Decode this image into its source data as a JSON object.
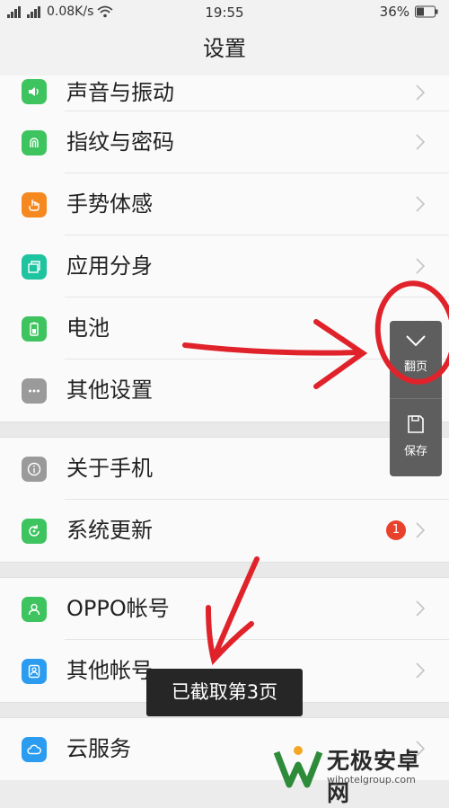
{
  "statusbar": {
    "network_text": "0.08K/s",
    "time": "19:55",
    "battery": "36%"
  },
  "header": {
    "title": "设置"
  },
  "groups": [
    {
      "items": [
        {
          "label": "声音与振动",
          "icon": "speaker-icon",
          "color": "#3ec45f"
        },
        {
          "label": "指纹与密码",
          "icon": "fingerprint-icon",
          "color": "#3ec45f"
        },
        {
          "label": "手势体感",
          "icon": "gesture-hand-icon",
          "color": "#f5891f"
        },
        {
          "label": "应用分身",
          "icon": "app-clone-icon",
          "color": "#1ec3a0"
        },
        {
          "label": "电池",
          "icon": "battery-icon",
          "color": "#3ec45f"
        },
        {
          "label": "其他设置",
          "icon": "more-dots-icon",
          "color": "#9a9a9a"
        }
      ]
    },
    {
      "items": [
        {
          "label": "关于手机",
          "icon": "info-icon",
          "color": "#9a9a9a"
        },
        {
          "label": "系统更新",
          "icon": "update-icon",
          "color": "#3ec45f",
          "badge": "1"
        }
      ]
    },
    {
      "items": [
        {
          "label": "OPPO帐号",
          "icon": "user-icon",
          "color": "#3ec45f"
        },
        {
          "label": "其他帐号",
          "icon": "user-outline-icon",
          "color": "#2b9cf0"
        }
      ]
    },
    {
      "items": [
        {
          "label": "云服务",
          "icon": "cloud-icon",
          "color": "#2b9cf0"
        }
      ]
    }
  ],
  "float_panel": {
    "page_label": "翻页",
    "save_label": "保存"
  },
  "toast": {
    "text": "已截取第3页"
  },
  "watermark": {
    "title": "无极安卓网",
    "url": "wjhotelgroup.com"
  },
  "colors": {
    "annotation_red": "#e0232b"
  }
}
